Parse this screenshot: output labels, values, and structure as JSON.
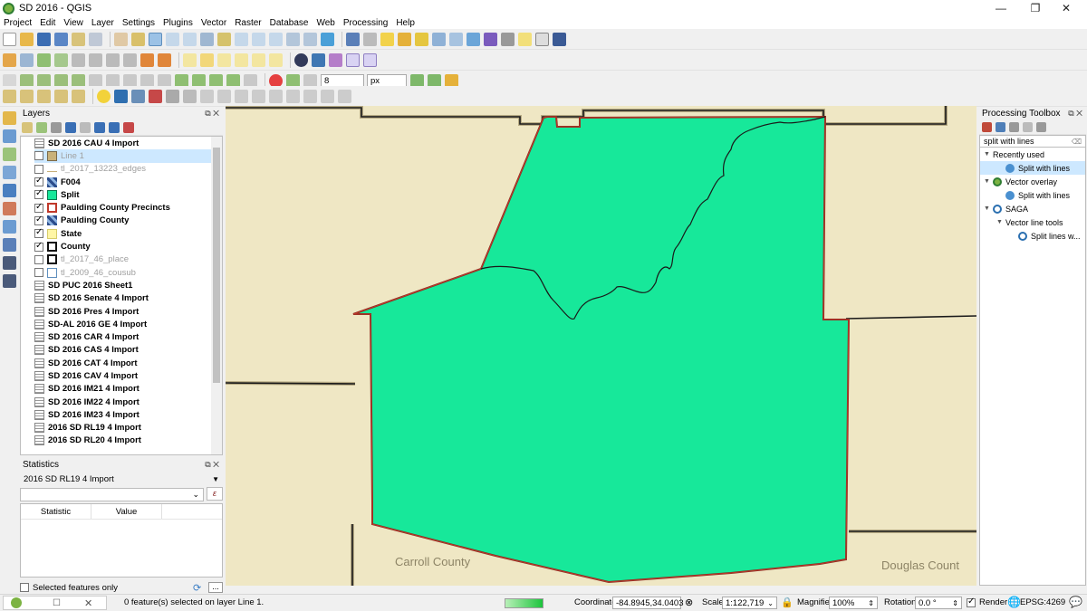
{
  "window": {
    "title": "SD 2016 - QGIS",
    "minimize": "—",
    "maximize": "❐",
    "close": "✕"
  },
  "menu": [
    "Project",
    "Edit",
    "View",
    "Layer",
    "Settings",
    "Plugins",
    "Vector",
    "Raster",
    "Database",
    "Web",
    "Processing",
    "Help"
  ],
  "digitizing": {
    "snap_tolerance": "8",
    "snap_unit": "px"
  },
  "layers_panel": {
    "title": "Layers",
    "items": [
      {
        "name": "SD 2016 CAU 4 Import",
        "checkbox": false,
        "icon": "table",
        "dim": false
      },
      {
        "name": "Line 1",
        "checkbox": true,
        "checked": false,
        "icon": "line-edit",
        "dim": true,
        "selected": true
      },
      {
        "name": "tl_2017_13223_edges",
        "checkbox": true,
        "checked": false,
        "icon": "line",
        "dim": true
      },
      {
        "name": "F004",
        "checkbox": true,
        "checked": true,
        "icon": "raster",
        "dim": false
      },
      {
        "name": "Split",
        "checkbox": true,
        "checked": true,
        "icon": "fill-green",
        "dim": false
      },
      {
        "name": "Paulding County Precincts",
        "checkbox": true,
        "checked": true,
        "icon": "fill-red",
        "dim": false
      },
      {
        "name": "Paulding County",
        "checkbox": true,
        "checked": true,
        "icon": "raster",
        "dim": false
      },
      {
        "name": "State",
        "checkbox": true,
        "checked": true,
        "icon": "fill-yellow",
        "dim": false
      },
      {
        "name": "County",
        "checkbox": true,
        "checked": true,
        "icon": "fill-black",
        "dim": false
      },
      {
        "name": "tl_2017_46_place",
        "checkbox": true,
        "checked": false,
        "icon": "fill-black",
        "dim": true
      },
      {
        "name": "tl_2009_46_cousub",
        "checkbox": true,
        "checked": false,
        "icon": "fill-blue",
        "dim": true
      },
      {
        "name": "SD PUC 2016 Sheet1",
        "checkbox": false,
        "icon": "table",
        "dim": false
      },
      {
        "name": "SD 2016 Senate 4 Import",
        "checkbox": false,
        "icon": "table",
        "dim": false
      },
      {
        "name": "SD 2016 Pres 4 Import",
        "checkbox": false,
        "icon": "table",
        "dim": false
      },
      {
        "name": "SD-AL 2016 GE 4 Import",
        "checkbox": false,
        "icon": "table",
        "dim": false
      },
      {
        "name": "SD 2016 CAR 4 Import",
        "checkbox": false,
        "icon": "table",
        "dim": false
      },
      {
        "name": "SD 2016 CAS 4 Import",
        "checkbox": false,
        "icon": "table",
        "dim": false
      },
      {
        "name": "SD 2016 CAT 4 Import",
        "checkbox": false,
        "icon": "table",
        "dim": false
      },
      {
        "name": "SD 2016 CAV 4 Import",
        "checkbox": false,
        "icon": "table",
        "dim": false
      },
      {
        "name": "SD 2016 IM21 4 Import",
        "checkbox": false,
        "icon": "table",
        "dim": false
      },
      {
        "name": "SD 2016 IM22 4 Import",
        "checkbox": false,
        "icon": "table",
        "dim": false
      },
      {
        "name": "SD 2016 IM23 4 Import",
        "checkbox": false,
        "icon": "table",
        "dim": false
      },
      {
        "name": "2016 SD RL19 4 Import",
        "checkbox": false,
        "icon": "table",
        "dim": false
      },
      {
        "name": "2016 SD RL20 4 Import",
        "checkbox": false,
        "icon": "table",
        "dim": false
      }
    ]
  },
  "statistics_panel": {
    "title": "Statistics",
    "layer": "2016 SD RL19 4 Import",
    "field": "",
    "columns": [
      "Statistic",
      "Value"
    ],
    "selected_only_label": "Selected features only",
    "more_button": "..."
  },
  "map": {
    "labels": [
      {
        "text": "Carroll County"
      },
      {
        "text": "Douglas Count"
      }
    ],
    "colors": {
      "background": "#efe7c4",
      "split_fill": "#17e89a",
      "precinct_outline": "#c0392b",
      "county_line": "#1a1a1a"
    }
  },
  "processing_toolbox": {
    "title": "Processing Toolbox",
    "search_value": "split with lines",
    "items": [
      {
        "level": 0,
        "label": "Recently used",
        "icon": "none",
        "expander": "▼"
      },
      {
        "level": 1,
        "label": "Split with lines",
        "icon": "gear",
        "selected": true
      },
      {
        "level": 0,
        "label": "Vector overlay",
        "icon": "qgis",
        "expander": "▼"
      },
      {
        "level": 1,
        "label": "Split with lines",
        "icon": "gear"
      },
      {
        "level": 0,
        "label": "SAGA",
        "icon": "saga",
        "expander": "▼"
      },
      {
        "level": 1,
        "label": "Vector line tools",
        "icon": "none",
        "expander": "▼"
      },
      {
        "level": 2,
        "label": "Split lines w...",
        "icon": "saga"
      }
    ]
  },
  "statusbar": {
    "message": "0 feature(s) selected on layer Line 1.",
    "coordinate_label": "Coordinate",
    "coordinate_value": "-84.8945,34.0403",
    "scale_label": "Scale",
    "scale_value": "1:122,719",
    "magnifier_label": "Magnifier",
    "magnifier_value": "100%",
    "rotation_label": "Rotation",
    "rotation_value": "0.0 °",
    "render_label": "Render",
    "crs": "EPSG:4269"
  }
}
